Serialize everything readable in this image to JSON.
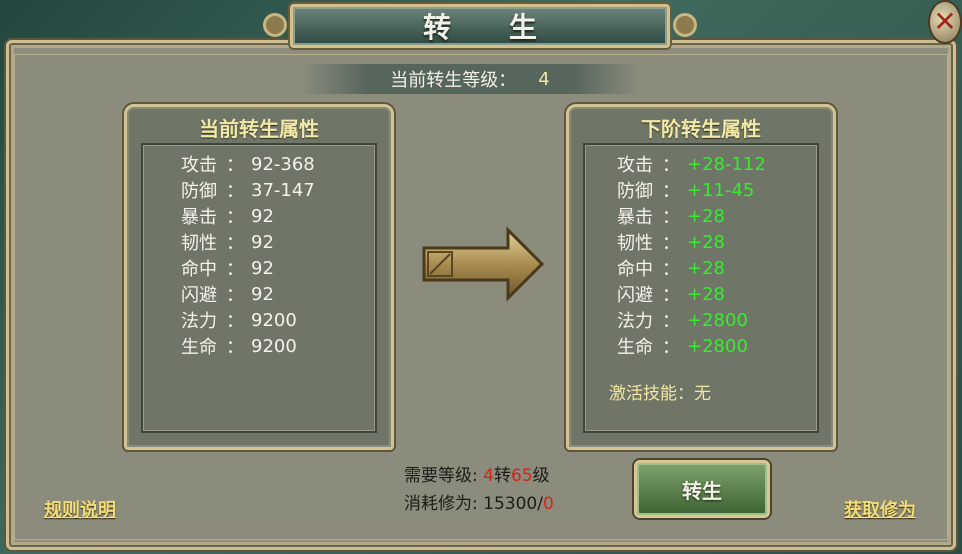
{
  "window": {
    "title": "转 生"
  },
  "header": {
    "level_label": "当前转生等级：",
    "level_value": "4"
  },
  "current_panel": {
    "title": "当前转生属性",
    "stats": [
      {
        "name": "攻击",
        "sep": "：",
        "value": "92-368"
      },
      {
        "name": "防御",
        "sep": "：",
        "value": "37-147"
      },
      {
        "name": "暴击",
        "sep": "：",
        "value": "92"
      },
      {
        "name": "韧性",
        "sep": "：",
        "value": "92"
      },
      {
        "name": "命中",
        "sep": "：",
        "value": "92"
      },
      {
        "name": "闪避",
        "sep": "：",
        "value": "92"
      },
      {
        "name": "法力",
        "sep": "：",
        "value": "9200"
      },
      {
        "name": "生命",
        "sep": "：",
        "value": "9200"
      }
    ]
  },
  "next_panel": {
    "title": "下阶转生属性",
    "stats": [
      {
        "name": "攻击",
        "sep": "：",
        "value": "+28-112"
      },
      {
        "name": "防御",
        "sep": "：",
        "value": "+11-45"
      },
      {
        "name": "暴击",
        "sep": "：",
        "value": "+28"
      },
      {
        "name": "韧性",
        "sep": "：",
        "value": "+28"
      },
      {
        "name": "命中",
        "sep": "：",
        "value": "+28"
      },
      {
        "name": "闪避",
        "sep": "：",
        "value": "+28"
      },
      {
        "name": "法力",
        "sep": "：",
        "value": "+2800"
      },
      {
        "name": "生命",
        "sep": "：",
        "value": "+2800"
      }
    ],
    "skill_label": "激活技能：",
    "skill_value": "无"
  },
  "requirements": {
    "level_label": "需要等级:",
    "level_rebirth": "4",
    "level_rebirth_unit": "转",
    "level_num": "65",
    "level_unit": "级",
    "cost_label": "消耗修为:",
    "cost_have": "15300",
    "cost_sep": "/",
    "cost_need": "0"
  },
  "buttons": {
    "rebirth": "转生"
  },
  "links": {
    "rules": "规则说明",
    "obtain": "获取修为"
  },
  "icons": {
    "close": "close-icon",
    "arrow": "right-arrow-icon"
  },
  "colors": {
    "green_value": "#35ec2e",
    "red_value": "#d8221a",
    "gold_text": "#f3e9a6"
  }
}
